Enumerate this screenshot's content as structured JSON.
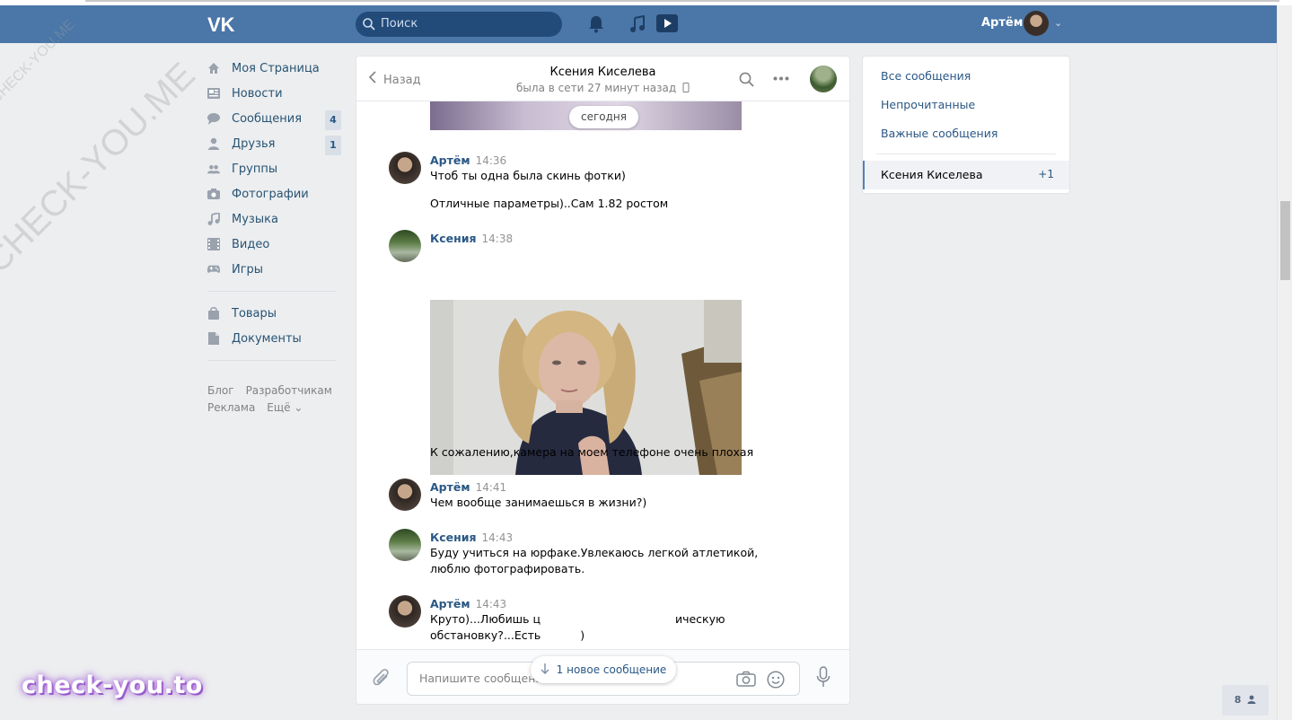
{
  "header": {
    "search_placeholder": "Поиск",
    "user_name": "Артём",
    "icons": [
      "bell-icon",
      "music-icon",
      "video-icon"
    ]
  },
  "watermark": {
    "text_large": "CHECK-YOU.ME",
    "text_small": "CHECK-YOU.ME"
  },
  "sidebar": {
    "items": [
      {
        "label": "Моя Страница",
        "icon": "home-icon"
      },
      {
        "label": "Новости",
        "icon": "news-icon"
      },
      {
        "label": "Сообщения",
        "icon": "messages-icon",
        "badge": "4"
      },
      {
        "label": "Друзья",
        "icon": "friends-icon",
        "badge": "1"
      },
      {
        "label": "Группы",
        "icon": "groups-icon"
      },
      {
        "label": "Фотографии",
        "icon": "camera-icon"
      },
      {
        "label": "Музыка",
        "icon": "music-icon"
      },
      {
        "label": "Видео",
        "icon": "video-icon"
      },
      {
        "label": "Игры",
        "icon": "games-icon"
      }
    ],
    "items2": [
      {
        "label": "Товары",
        "icon": "bag-icon"
      },
      {
        "label": "Документы",
        "icon": "document-icon"
      }
    ],
    "footer": {
      "blog": "Блог",
      "developers": "Разработчикам",
      "ads": "Реклама",
      "more": "Ещё ⌄"
    }
  },
  "chat": {
    "back_label": "Назад",
    "title": "Ксения Киселева",
    "status": "была в сети 27 минут назад",
    "date_divider": "сегодня",
    "messages": [
      {
        "author": "Артём",
        "time": "14:36",
        "lines": [
          "Чтоб ты одна была скинь фотки)",
          "Отличные параметры)..Сам 1.82 ростом"
        ]
      },
      {
        "author": "Ксения",
        "time": "14:38",
        "caption": "К сожалению,камера на моем телефоне очень плохая"
      },
      {
        "author": "Артём",
        "time": "14:41",
        "text": "Чем вообще занимаешься в жизни?)"
      },
      {
        "author": "Ксения",
        "time": "14:43",
        "text": "Буду учиться на юрфаке.Увлекаюсь легкой атлетикой, люблю фотографировать."
      },
      {
        "author": "Артём",
        "time": "14:43",
        "line1_start": "Круто)...Любишь ц",
        "line1_end": "ическую",
        "line2_start": "обстановку?...Есть ",
        "line2_end": ")"
      }
    ],
    "new_messages": "1 новое сообщение",
    "compose_placeholder": "Напишите сообщение..."
  },
  "right_panel": {
    "all": "Все сообщения",
    "unread": "Непрочитанные",
    "important": "Важные сообщения",
    "active_name": "Ксения Киселева",
    "active_count": "+1"
  },
  "brand": "check-you.to",
  "online_count": "8"
}
